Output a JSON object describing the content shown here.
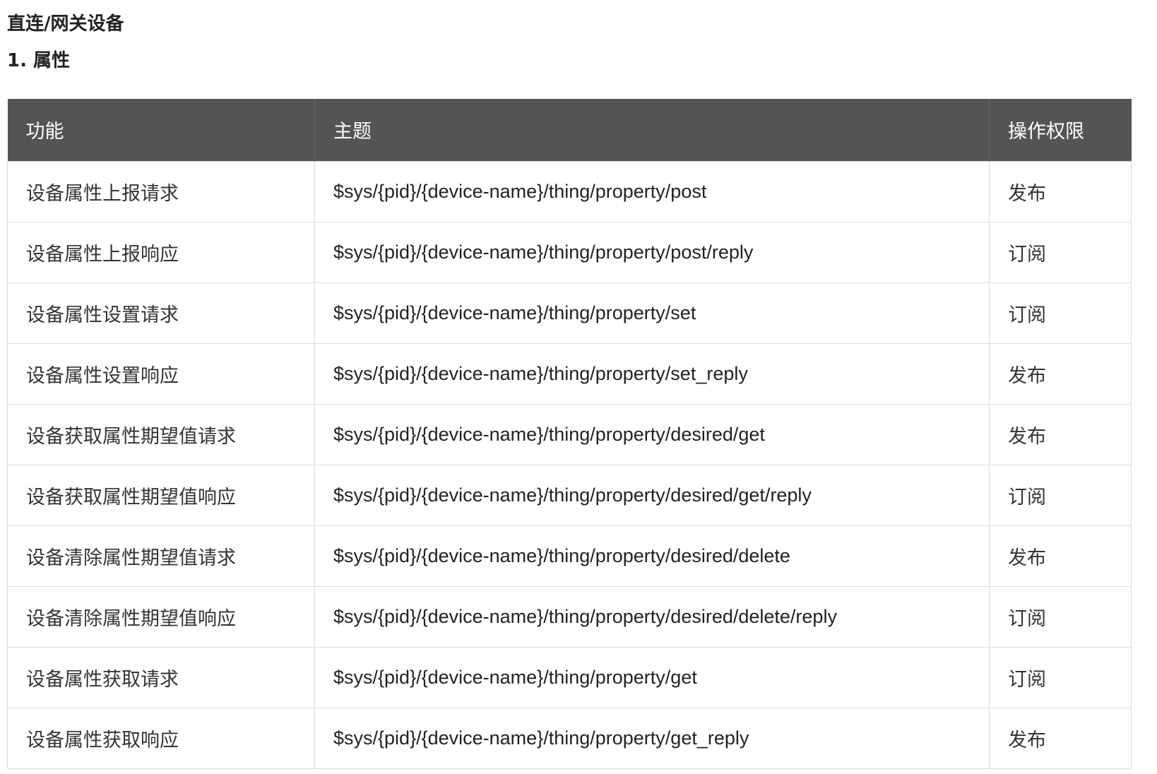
{
  "heading": "直连/网关设备",
  "subheading": "1. 属性",
  "table": {
    "headers": {
      "function": "功能",
      "topic": "主题",
      "permission": "操作权限"
    },
    "rows": [
      {
        "function": "设备属性上报请求",
        "topic": "$sys/{pid}/{device-name}/thing/property/post",
        "permission": "发布"
      },
      {
        "function": "设备属性上报响应",
        "topic": "$sys/{pid}/{device-name}/thing/property/post/reply",
        "permission": "订阅"
      },
      {
        "function": "设备属性设置请求",
        "topic": "$sys/{pid}/{device-name}/thing/property/set",
        "permission": "订阅"
      },
      {
        "function": "设备属性设置响应",
        "topic": "$sys/{pid}/{device-name}/thing/property/set_reply",
        "permission": "发布"
      },
      {
        "function": "设备获取属性期望值请求",
        "topic": "$sys/{pid}/{device-name}/thing/property/desired/get",
        "permission": "发布"
      },
      {
        "function": "设备获取属性期望值响应",
        "topic": "$sys/{pid}/{device-name}/thing/property/desired/get/reply",
        "permission": "订阅"
      },
      {
        "function": "设备清除属性期望值请求",
        "topic": "$sys/{pid}/{device-name}/thing/property/desired/delete",
        "permission": "发布"
      },
      {
        "function": "设备清除属性期望值响应",
        "topic": "$sys/{pid}/{device-name}/thing/property/desired/delete/reply",
        "permission": "订阅"
      },
      {
        "function": "设备属性获取请求",
        "topic": "$sys/{pid}/{device-name}/thing/property/get",
        "permission": "订阅"
      },
      {
        "function": "设备属性获取响应",
        "topic": "$sys/{pid}/{device-name}/thing/property/get_reply",
        "permission": "发布"
      }
    ]
  }
}
